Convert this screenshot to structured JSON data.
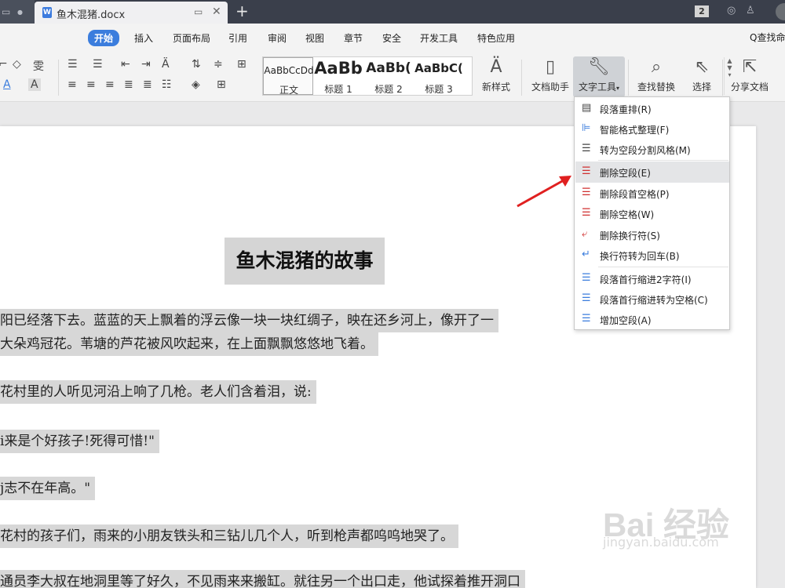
{
  "titlebar": {
    "doc_tab_name": "鱼木混猪.docx",
    "doc_icon_letter": "W",
    "new_tab": "+",
    "badge": "2"
  },
  "menu": {
    "items": [
      "开始",
      "插入",
      "页面布局",
      "引用",
      "审阅",
      "视图",
      "章节",
      "安全",
      "开发工具",
      "特色应用"
    ],
    "find": "Q查找命"
  },
  "ribbon": {
    "styles": [
      {
        "preview": "AaBbCcDd",
        "label": "正文"
      },
      {
        "preview": "AaBb",
        "label": "标题 1"
      },
      {
        "preview": "AaBb(",
        "label": "标题 2"
      },
      {
        "preview": "AaBbC(",
        "label": "标题 3"
      }
    ],
    "new_style": "新样式",
    "doc_helper": "文档助手",
    "text_tools": "文字工具",
    "find_replace": "查找替换",
    "select": "选择",
    "share": "分享文档"
  },
  "dropdown": {
    "items": [
      {
        "label": "段落重排(R)",
        "icon": "paragraph-reflow-icon"
      },
      {
        "label": "智能格式整理(F)",
        "icon": "smart-format-icon"
      },
      {
        "label": "转为空段分割风格(M)",
        "icon": "split-style-icon"
      },
      {
        "label": "删除空段(E)",
        "icon": "delete-empty-paragraph-icon"
      },
      {
        "label": "删除段首空格(P)",
        "icon": "delete-leading-space-icon"
      },
      {
        "label": "删除空格(W)",
        "icon": "delete-space-icon"
      },
      {
        "label": "删除换行符(S)",
        "icon": "delete-line-break-icon"
      },
      {
        "label": "换行符转为回车(B)",
        "icon": "line-break-to-enter-icon"
      },
      {
        "label": "段落首行缩进2字符(I)",
        "icon": "indent-2-chars-icon"
      },
      {
        "label": "段落首行缩进转为空格(C)",
        "icon": "indent-to-space-icon"
      },
      {
        "label": "增加空段(A)",
        "icon": "add-empty-paragraph-icon"
      }
    ],
    "highlighted": "删除空段(E)"
  },
  "document": {
    "title": "鱼木混猪的故事",
    "paragraphs": [
      "阳已经落下去。蓝蓝的天上飘着的浮云像一块一块红绸子，映在还乡河上，像开了一",
      "大朵鸡冠花。苇塘的芦花被风吹起来，在上面飘飘悠悠地飞着。",
      "花村里的人听见河沿上响了几枪。老人们含着泪，说:",
      "i来是个好孩子!死得可惜!\"",
      "j志不在年高。\"",
      "花村的孩子们，雨来的小朋友铁头和三钻儿几个人，听到枪声都呜呜地哭了。",
      "通员李大叔在地洞里等了好久，不见雨来来搬缸。就往另一个出口走，他试探着推开洞口"
    ]
  },
  "watermark": {
    "main": "Bai 经验",
    "sub": "jingyan.baidu.com"
  },
  "colors": {
    "titlebar": "#3a3f4b",
    "accent": "#3b7ddd",
    "highlight": "#d7d7d7",
    "arrow": "#e02020"
  }
}
